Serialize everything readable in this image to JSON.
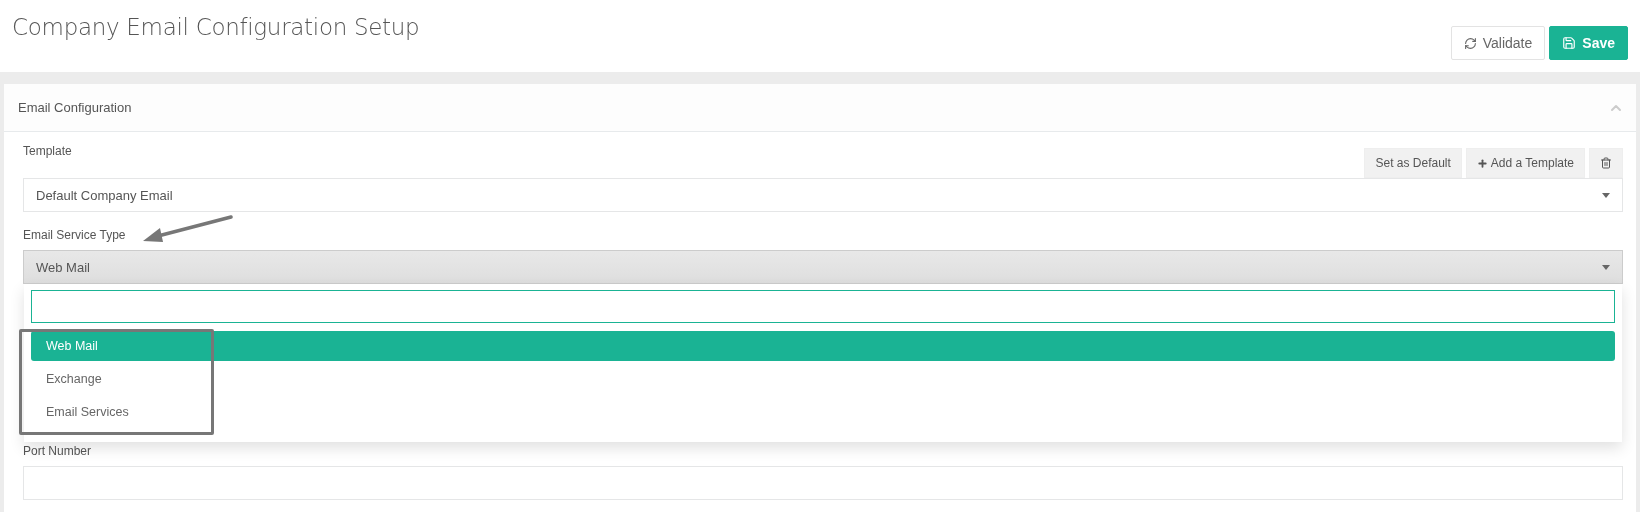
{
  "page": {
    "title": "Company Email Configuration Setup"
  },
  "actions": [
    {
      "kind": "validate",
      "label": "Validate"
    },
    {
      "kind": "save",
      "label": "Save"
    }
  ],
  "panel": {
    "title": "Email Configuration",
    "expanded": true,
    "template": {
      "label": "Template",
      "value": "Default Company Email",
      "buttons": [
        {
          "kind": "text",
          "label": "Set as Default"
        },
        {
          "kind": "add",
          "label": "Add a Template"
        },
        {
          "kind": "delete"
        }
      ]
    },
    "service_type": {
      "label": "Email Service Type",
      "value": "Web Mail",
      "open": true,
      "options": [
        {
          "label": "Web Mail",
          "selected": true
        },
        {
          "label": "Exchange",
          "selected": false
        },
        {
          "label": "Email Services",
          "selected": false
        }
      ]
    },
    "port": {
      "label": "Port Number"
    }
  }
}
